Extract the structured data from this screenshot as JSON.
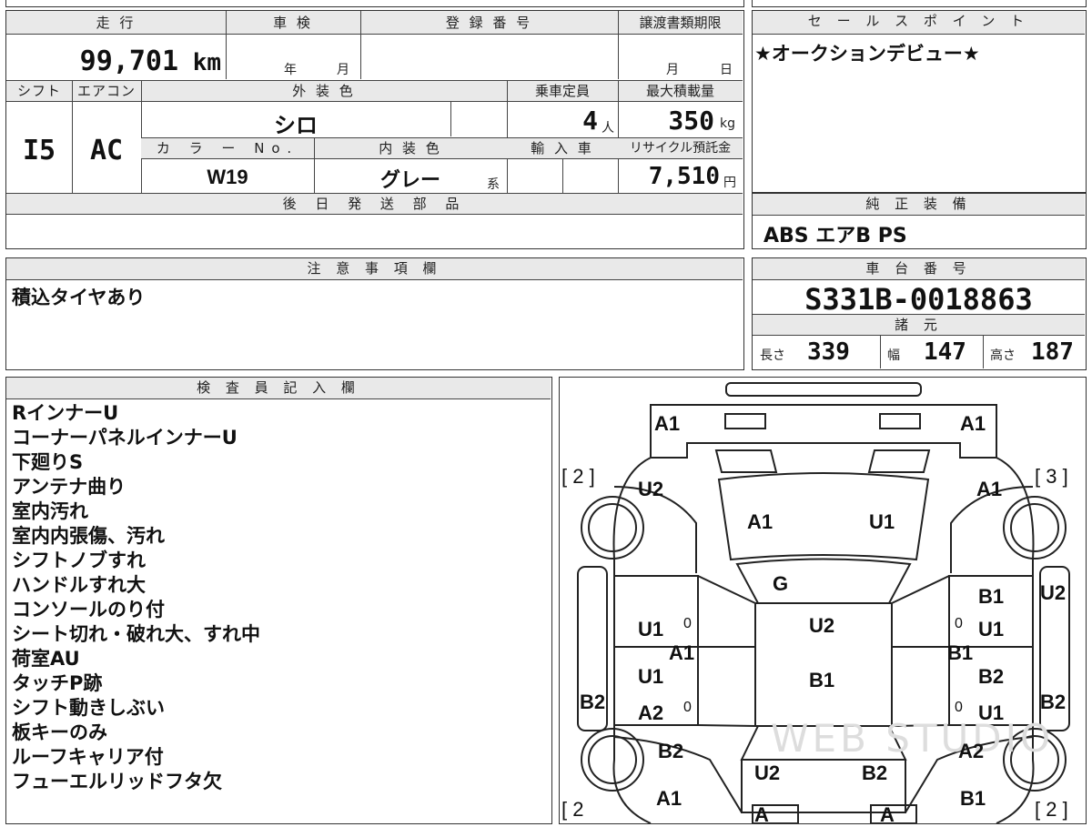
{
  "vehicle": {
    "mileage_header": "走 行",
    "mileage": "99,701",
    "mileage_unit": "km",
    "inspection_header": "車 検",
    "inspection_year_unit": "年",
    "inspection_month_unit": "月",
    "registration_header": "登 録 番 号",
    "transfer_deadline_header": "譲渡書類期限",
    "transfer_month_unit": "月",
    "transfer_day_unit": "日",
    "shift_header": "シフト",
    "shift": "I5",
    "ac_header": "エアコン",
    "ac": "AC",
    "exterior_color_header": "外 装 色",
    "exterior_color": "シロ",
    "capacity_header": "乗車定員",
    "capacity": "4",
    "capacity_unit": "人",
    "max_load_header": "最大積載量",
    "max_load": "350",
    "max_load_unit": "kg",
    "color_no_header": "カ ラ ー No.",
    "color_no": "W19",
    "interior_color_header": "内 装 色",
    "interior_color": "グレー",
    "interior_color_suffix": "系",
    "import_header": "輸 入 車",
    "recycle_header": "リサイクル預託金",
    "recycle_fee": "7,510",
    "recycle_unit": "円",
    "later_parts_header": "後 日 発 送 部 品"
  },
  "sales_point": {
    "header": "セ ー ル ス ポ イ ン ト",
    "text": "★オークションデビュー★"
  },
  "genuine_equipment": {
    "header": "純 正 装 備",
    "text": "ABS エアB PS"
  },
  "caution": {
    "header": "注 意 事 項 欄",
    "text": "積込タイヤあり"
  },
  "chassis": {
    "header": "車 台 番 号",
    "number": "S331B-0018863",
    "spec_header": "諸 元",
    "length_label": "長さ",
    "length": "339",
    "width_label": "幅",
    "width": "147",
    "height_label": "高さ",
    "height": "187"
  },
  "inspector": {
    "header": "検 査 員 記 入 欄",
    "notes": [
      "RインナーU",
      "コーナーパネルインナーU",
      "下廻りS",
      "アンテナ曲り",
      "室内汚れ",
      "室内内張傷、汚れ",
      "シフトノブすれ",
      "ハンドルすれ大",
      "コンソールのり付",
      "シート切れ・破れ大、すれ中",
      "荷室AU",
      "タッチP跡",
      "シフト動きしぶい",
      "板キーのみ",
      "ルーフキャリア付",
      "フューエルリッドフタ欠"
    ]
  },
  "diagram": {
    "brackets": {
      "top_left": "[ 2 ]",
      "top_right": "[ 3 ]",
      "bottom_left": "[ 2",
      "bottom_right": "[ 2 ]"
    },
    "marks": {
      "front_left": "A1",
      "front_right": "A1",
      "fender_left": "U2",
      "fender_right": "A1",
      "hood_left": "A1",
      "hood_right": "U1",
      "windshield": "G",
      "roof_top": "U2",
      "roof_bottom": "B1",
      "side_right_top": "U2",
      "front_door_left_top": "U1",
      "front_door_left_seam": "A1",
      "rear_door_left_top": "U1",
      "rear_door_left_bottom": "A2",
      "front_door_right_top": "B1",
      "front_door_right_mid": "U1",
      "front_door_right_seam": "B1",
      "rear_door_right_top": "B2",
      "rear_door_right_bottom": "U1",
      "side_left_bottom": "B2",
      "side_right_bottom": "B2",
      "rear_fender_left": "B2",
      "rear_fender_right": "A2",
      "tailgate_left": "U2",
      "tailgate_right": "B2",
      "rear_left": "A1",
      "rear_right": "B1",
      "bumper_left": "A",
      "bumper_right": "A",
      "zero_1": "0",
      "zero_2": "0",
      "zero_3": "0",
      "zero_4": "0"
    },
    "watermark": "WEB STUDIO"
  }
}
